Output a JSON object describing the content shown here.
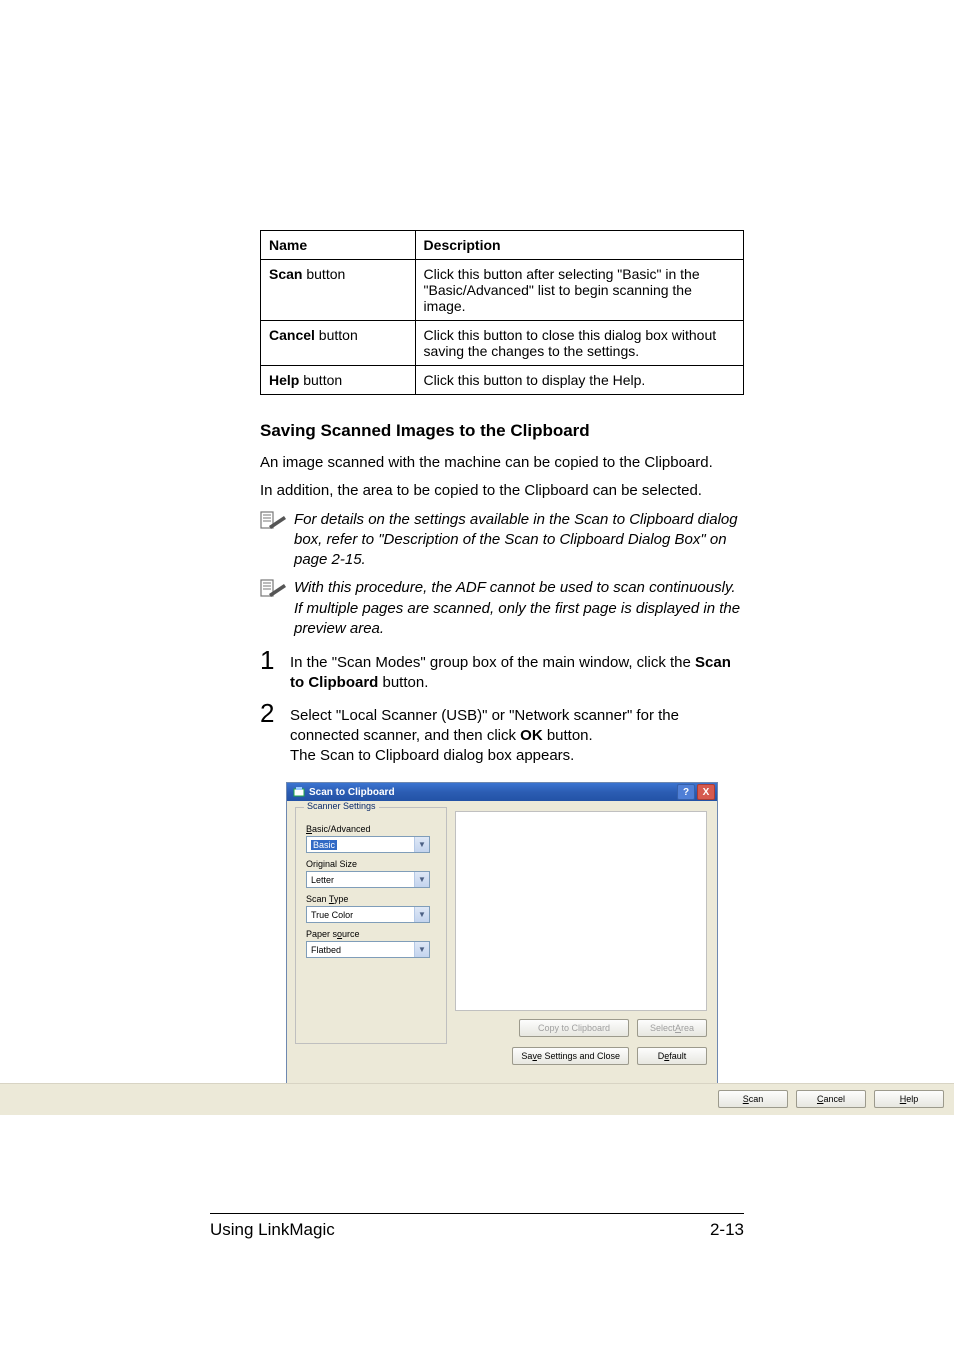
{
  "table": {
    "headers": [
      "Name",
      "Description"
    ],
    "rows": [
      {
        "name_bold": "Scan",
        "name_rest": " button",
        "desc": "Click this button after selecting \"Basic\" in the \"Basic/Advanced\" list to begin scanning the image."
      },
      {
        "name_bold": "Cancel",
        "name_rest": " button",
        "desc": "Click this button to close this dialog box without saving the changes to the settings."
      },
      {
        "name_bold": "Help",
        "name_rest": " button",
        "desc": "Click this button to display the Help."
      }
    ]
  },
  "section_heading": "Saving Scanned Images to the Clipboard",
  "para1": "An image scanned with the machine can be copied to the Clipboard.",
  "para2": "In addition, the area to be copied to the Clipboard can be selected.",
  "note1": "For details on the settings available in the Scan to Clipboard dialog box, refer to \"Description of the Scan to Clipboard Dialog Box\" on page 2-15.",
  "note2": "With this procedure, the ADF cannot be used to scan continuously. If multiple pages are scanned, only the first page is displayed in the preview area.",
  "steps": {
    "s1_pre": "In the \"Scan Modes\" group box of the main window, click the ",
    "s1_bold": "Scan to Clipboard",
    "s1_post": " button.",
    "s2_line1_pre": "Select \"Local Scanner (USB)\" or \"Network scanner\" for the connected scanner, and then click ",
    "s2_line1_bold": "OK",
    "s2_line1_post": " button.",
    "s2_line2": "The Scan to Clipboard dialog box appears."
  },
  "dialog": {
    "title": "Scan to Clipboard",
    "group_legend": "Scanner Settings",
    "labels": {
      "basic_adv": "Basic/Advanced",
      "orig_size": "Original Size",
      "scan_type": "Scan Type",
      "paper_src": "Paper source"
    },
    "values": {
      "basic_adv": "Basic",
      "orig_size": "Letter",
      "scan_type": "True Color",
      "paper_src": "Flatbed"
    },
    "buttons": {
      "copy": "Copy to Clipboard",
      "select_area": "Select Area",
      "save_close": "Save Settings and Close",
      "default": "Default",
      "scan": "Scan",
      "cancel": "Cancel",
      "help": "Help"
    },
    "titlebar_help": "?",
    "titlebar_close": "X"
  },
  "footer": {
    "left": "Using LinkMagic",
    "right": "2-13"
  }
}
